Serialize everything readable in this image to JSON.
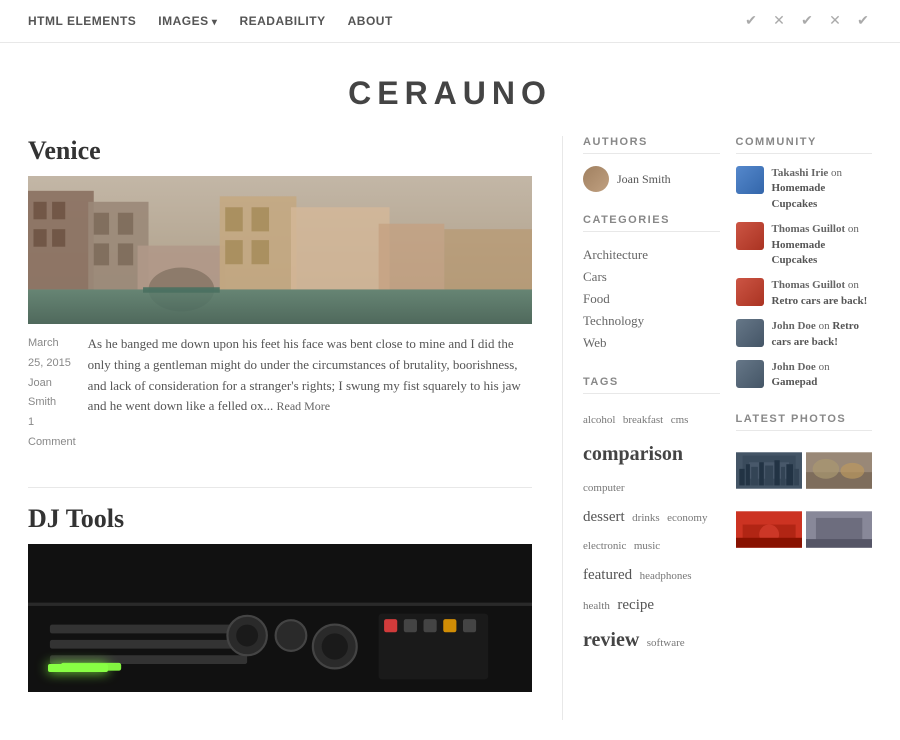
{
  "site": {
    "title": "CERAUNO"
  },
  "nav": {
    "links": [
      {
        "label": "HTML ELEMENTS",
        "has_arrow": false
      },
      {
        "label": "IMAGES",
        "has_arrow": true
      },
      {
        "label": "READABILITY",
        "has_arrow": false
      },
      {
        "label": "ABOUT",
        "has_arrow": false
      }
    ]
  },
  "articles": [
    {
      "title": "Venice",
      "date": "March 25, 2015",
      "author": "Joan Smith",
      "comments": "1 Comment",
      "excerpt": "As he banged me down upon his feet his face was bent close to mine and I did the only thing a gentleman might do under the circumstances of brutality, boorishness, and lack of consideration for a stranger's rights; I swung my fist squarely to his jaw and he went down like a felled ox...",
      "read_more": "Read More"
    },
    {
      "title": "DJ Tools",
      "date": "",
      "author": "",
      "comments": "",
      "excerpt": "",
      "read_more": ""
    }
  ],
  "sidebar": {
    "authors_heading": "AUTHORS",
    "authors": [
      {
        "name": "Joan Smith"
      }
    ],
    "categories_heading": "CATEGORIES",
    "categories": [
      {
        "label": "Architecture"
      },
      {
        "label": "Cars"
      },
      {
        "label": "Food"
      },
      {
        "label": "Technology"
      },
      {
        "label": "Web"
      }
    ],
    "tags_heading": "TAGS",
    "tags": [
      {
        "label": "alcohol",
        "size": "small"
      },
      {
        "label": "breakfast",
        "size": "small"
      },
      {
        "label": "cms",
        "size": "small"
      },
      {
        "label": "comparison",
        "size": "large"
      },
      {
        "label": "computer",
        "size": "small"
      },
      {
        "label": "dessert",
        "size": "medium"
      },
      {
        "label": "drinks",
        "size": "small"
      },
      {
        "label": "economy",
        "size": "small"
      },
      {
        "label": "electronic",
        "size": "small"
      },
      {
        "label": "music",
        "size": "small"
      },
      {
        "label": "featured",
        "size": "medium"
      },
      {
        "label": "headphones",
        "size": "small"
      },
      {
        "label": "health",
        "size": "small"
      },
      {
        "label": "recipe",
        "size": "medium"
      },
      {
        "label": "review",
        "size": "large"
      },
      {
        "label": "software",
        "size": "small"
      }
    ],
    "community_heading": "COMMUNITY",
    "community": [
      {
        "user": "Takashi Irie",
        "action": "on",
        "post": "Homemade Cupcakes",
        "avatar_class": "av-blue"
      },
      {
        "user": "Thomas Guillot",
        "action": "on",
        "post": "Homemade Cupcakes",
        "avatar_class": "av-red1"
      },
      {
        "user": "Thomas Guillot",
        "action": "on",
        "post": "Retro cars are back!",
        "avatar_class": "av-red2"
      },
      {
        "user": "John Doe",
        "action": "on",
        "post": "Retro cars are back!",
        "avatar_class": "av-gray1"
      },
      {
        "user": "John Doe",
        "action": "on",
        "post": "Gamepad",
        "avatar_class": "av-gray2"
      }
    ],
    "photos_heading": "LATEST PHOTOS",
    "photos": [
      {
        "class": "ph1"
      },
      {
        "class": "ph2"
      },
      {
        "class": "ph3"
      },
      {
        "class": "ph4"
      }
    ]
  }
}
